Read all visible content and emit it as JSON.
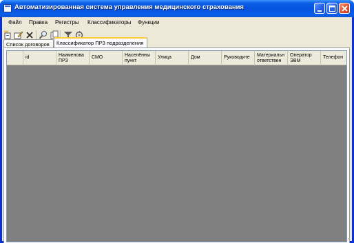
{
  "window": {
    "title": "Автоматизированная система управления медицинского страхования",
    "title_color": "#ffffff",
    "titlebar_color": "#0653e0"
  },
  "titlebar_buttons": [
    "minimize-icon",
    "maximize-icon",
    "close-icon"
  ],
  "menu": {
    "items": [
      "Файл",
      "Правка",
      "Регистры",
      "Классификаторы",
      "Функции"
    ]
  },
  "toolbar": {
    "buttons": [
      "new-record-icon",
      "edit-record-icon",
      "delete-icon",
      "search-icon",
      "copy-icon",
      "filter-icon",
      "refresh-icon"
    ]
  },
  "tabs": [
    {
      "label": "Список договоров",
      "active": false
    },
    {
      "label": "Классификатор ПРЗ подразделения",
      "active": true
    }
  ],
  "grid": {
    "columns": [
      "id",
      "Наименова\nПРЗ",
      "СМО",
      "Населённы\nпункт",
      "Улица",
      "Дом",
      "Руководите",
      "Материальн\nответствен",
      "Оператор\nЭВМ",
      "Телефон"
    ],
    "rows": [],
    "empty_area_color": "#808080"
  }
}
